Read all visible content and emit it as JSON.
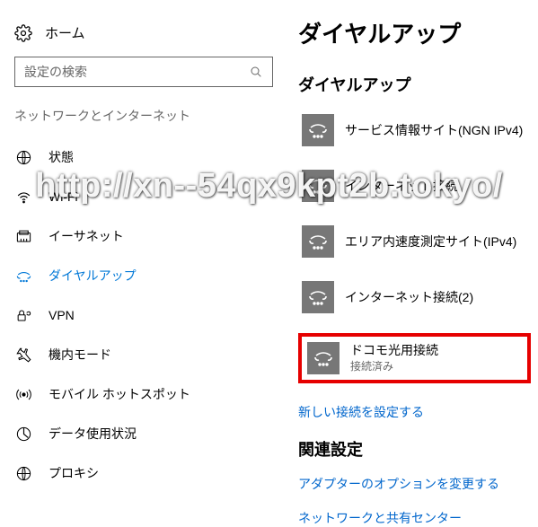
{
  "sidebar": {
    "home_label": "ホーム",
    "search_placeholder": "設定の検索",
    "category_label": "ネットワークとインターネット",
    "items": [
      {
        "label": "状態"
      },
      {
        "label": "Wi-Fi"
      },
      {
        "label": "イーサネット"
      },
      {
        "label": "ダイヤルアップ"
      },
      {
        "label": "VPN"
      },
      {
        "label": "機内モード"
      },
      {
        "label": "モバイル ホットスポット"
      },
      {
        "label": "データ使用状況"
      },
      {
        "label": "プロキシ"
      }
    ]
  },
  "main": {
    "page_title": "ダイヤルアップ",
    "section_title": "ダイヤルアップ",
    "connections": [
      {
        "title": "サービス情報サイト(NGN IPv4)",
        "sub": ""
      },
      {
        "title": "インターネット接続",
        "sub": ""
      },
      {
        "title": "エリア内速度測定サイト(IPv4)",
        "sub": ""
      },
      {
        "title": "インターネット接続(2)",
        "sub": ""
      },
      {
        "title": "ドコモ光用接続",
        "sub": "接続済み"
      }
    ],
    "setup_link": "新しい接続を設定する",
    "related_title": "関連設定",
    "related_links": [
      "アダプターのオプションを変更する",
      "ネットワークと共有センター"
    ]
  },
  "watermark": "http://xn--54qx9kpt2b.tokyo/"
}
